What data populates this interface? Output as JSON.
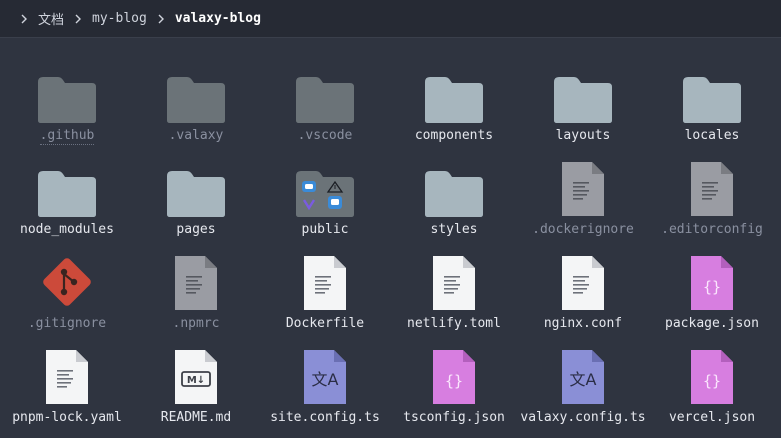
{
  "breadcrumb": {
    "items": [
      "文档",
      "my-blog",
      "valaxy-blog"
    ]
  },
  "files": [
    {
      "name": ".github",
      "kind": "folder-dim"
    },
    {
      "name": ".valaxy",
      "kind": "folder-dim"
    },
    {
      "name": ".vscode",
      "kind": "folder-dim"
    },
    {
      "name": "components",
      "kind": "folder"
    },
    {
      "name": "layouts",
      "kind": "folder"
    },
    {
      "name": "locales",
      "kind": "folder"
    },
    {
      "name": "node_modules",
      "kind": "folder"
    },
    {
      "name": "pages",
      "kind": "folder"
    },
    {
      "name": "public",
      "kind": "folder-public"
    },
    {
      "name": "styles",
      "kind": "folder"
    },
    {
      "name": ".dockerignore",
      "kind": "text-dim"
    },
    {
      "name": ".editorconfig",
      "kind": "text-dim"
    },
    {
      "name": ".gitignore",
      "kind": "git"
    },
    {
      "name": ".npmrc",
      "kind": "text-dim"
    },
    {
      "name": "Dockerfile",
      "kind": "text"
    },
    {
      "name": "netlify.toml",
      "kind": "text"
    },
    {
      "name": "nginx.conf",
      "kind": "text"
    },
    {
      "name": "package.json",
      "kind": "json"
    },
    {
      "name": "pnpm-lock.yaml",
      "kind": "text"
    },
    {
      "name": "README.md",
      "kind": "markdown"
    },
    {
      "name": "site.config.ts",
      "kind": "ts"
    },
    {
      "name": "tsconfig.json",
      "kind": "json"
    },
    {
      "name": "valaxy.config.ts",
      "kind": "ts"
    },
    {
      "name": "vercel.json",
      "kind": "json"
    }
  ],
  "colors": {
    "folder": "#a7b6be",
    "folder_dim": "#6b7378",
    "doc": "#f4f5f6",
    "doc_dim": "#9a9ca3",
    "json": "#d77ee0",
    "ts": "#8a8fd6",
    "git": "#cc4a3a"
  }
}
